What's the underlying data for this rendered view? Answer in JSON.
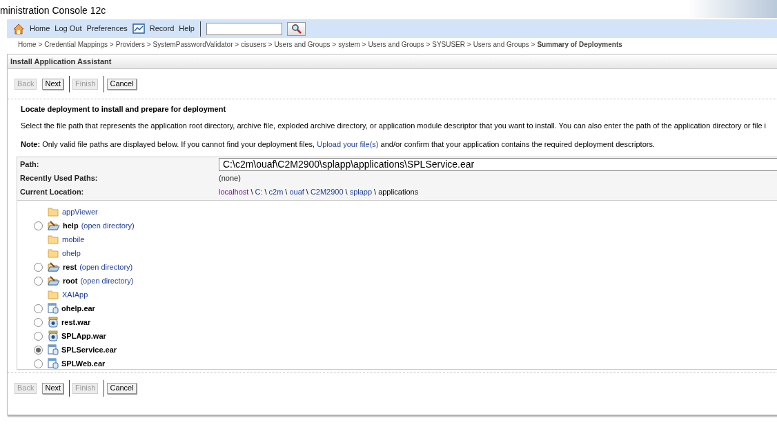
{
  "window": {
    "title": "ministration Console 12c"
  },
  "nav": {
    "links": [
      {
        "kind": "home",
        "label": "Home"
      },
      {
        "kind": "text",
        "label": "Log Out"
      },
      {
        "kind": "text",
        "label": "Preferences"
      },
      {
        "kind": "record",
        "label": "Record"
      },
      {
        "kind": "text",
        "label": "Help"
      }
    ]
  },
  "breadcrumbs": [
    {
      "label": "Home >",
      "current": false
    },
    {
      "label": "Credential Mappings >",
      "current": false
    },
    {
      "label": "Providers >",
      "current": false
    },
    {
      "label": "SystemPasswordValidator >",
      "current": false
    },
    {
      "label": "cisusers >",
      "current": false
    },
    {
      "label": "Users and Groups >",
      "current": false
    },
    {
      "label": "system >",
      "current": false
    },
    {
      "label": "Users and Groups >",
      "current": false
    },
    {
      "label": "SYSUSER >",
      "current": false
    },
    {
      "label": "Users and Groups >",
      "current": false
    },
    {
      "label": "Summary of Deployments",
      "current": true
    }
  ],
  "panel": {
    "title": "Install Application Assistant",
    "buttons_top": [
      [
        {
          "label": "Back",
          "disabled": true
        },
        {
          "label": "Next",
          "disabled": false
        }
      ],
      [
        {
          "label": "Finish",
          "disabled": true
        }
      ],
      [
        {
          "label": "Cancel",
          "disabled": false
        }
      ]
    ],
    "heading": "Locate deployment to install and prepare for deployment",
    "description": "Select the file path that represents the application root directory, archive file, exploded archive directory, or application module descriptor that you want to install. You can also enter the path of the application directory or file i",
    "note": {
      "label": "Note:",
      "before": "Only valid file paths are displayed below. If you cannot find your deployment files,",
      "link": "Upload your file(s)",
      "after": "and/or confirm that your application contains the required deployment descriptors."
    },
    "path": {
      "label": "Path:",
      "value": "C:\\c2m\\ouaf\\C2M2900\\splapp\\applications\\SPLService.ear"
    },
    "recent": {
      "label": "Recently Used Paths:",
      "value": "(none)"
    },
    "location": {
      "label": "Current Location:",
      "parts": [
        {
          "label": "localhost",
          "link": true,
          "visited": true,
          "separator": "\\"
        },
        {
          "label": "C:",
          "link": true,
          "visited": false,
          "separator": "\\"
        },
        {
          "label": "c2m",
          "link": true,
          "visited": false,
          "separator": "\\"
        },
        {
          "label": "ouaf",
          "link": true,
          "visited": false,
          "separator": "\\"
        },
        {
          "label": "C2M2900",
          "link": true,
          "visited": false,
          "separator": "\\"
        },
        {
          "label": "splapp",
          "link": true,
          "visited": false,
          "separator": "\\"
        },
        {
          "label": "applications",
          "link": false
        }
      ]
    },
    "files": [
      {
        "kind": "folder",
        "label": "appViewer"
      },
      {
        "kind": "open_dir",
        "label": "help",
        "link": "(open directory)",
        "selected": false
      },
      {
        "kind": "folder",
        "label": "mobile"
      },
      {
        "kind": "folder",
        "label": "ohelp"
      },
      {
        "kind": "open_dir",
        "label": "rest",
        "link": "(open directory)",
        "selected": false
      },
      {
        "kind": "open_dir",
        "label": "root",
        "link": "(open directory)",
        "selected": false
      },
      {
        "kind": "folder",
        "label": "XAIApp"
      },
      {
        "kind": "ear",
        "label": "ohelp.ear",
        "selected": false
      },
      {
        "kind": "war",
        "label": "rest.war",
        "selected": false
      },
      {
        "kind": "war",
        "label": "SPLApp.war",
        "selected": false
      },
      {
        "kind": "ear",
        "label": "SPLService.ear",
        "selected": true
      },
      {
        "kind": "ear",
        "label": "SPLWeb.ear",
        "selected": false
      }
    ],
    "buttons_bottom": [
      [
        {
          "label": "Back",
          "disabled": true
        },
        {
          "label": "Next",
          "disabled": false
        }
      ],
      [
        {
          "label": "Finish",
          "disabled": true
        }
      ],
      [
        {
          "label": "Cancel",
          "disabled": false
        }
      ]
    ]
  }
}
